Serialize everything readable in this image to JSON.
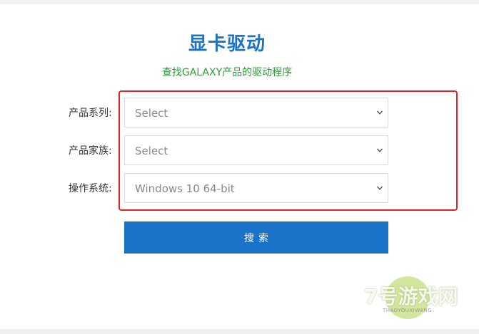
{
  "header": {
    "title": "显卡驱动",
    "subtitle": "查找GALAXY产品的驱动程序"
  },
  "form": {
    "fields": [
      {
        "label": "产品系列:",
        "value": "Select"
      },
      {
        "label": "产品家族:",
        "value": "Select"
      },
      {
        "label": "操作系统:",
        "value": "Windows 10 64-bit"
      }
    ],
    "search_label": "搜索"
  },
  "watermark": {
    "text": "7号游戏网",
    "subtext": "THAOYOUXIWANG"
  },
  "colors": {
    "title": "#1a73c9",
    "subtitle": "#2a9a3a",
    "button": "#1a73c9",
    "highlight": "#e32222",
    "select_border": "#d9d9d9"
  },
  "icons": {
    "select_arrow": "chevron-down-icon"
  }
}
